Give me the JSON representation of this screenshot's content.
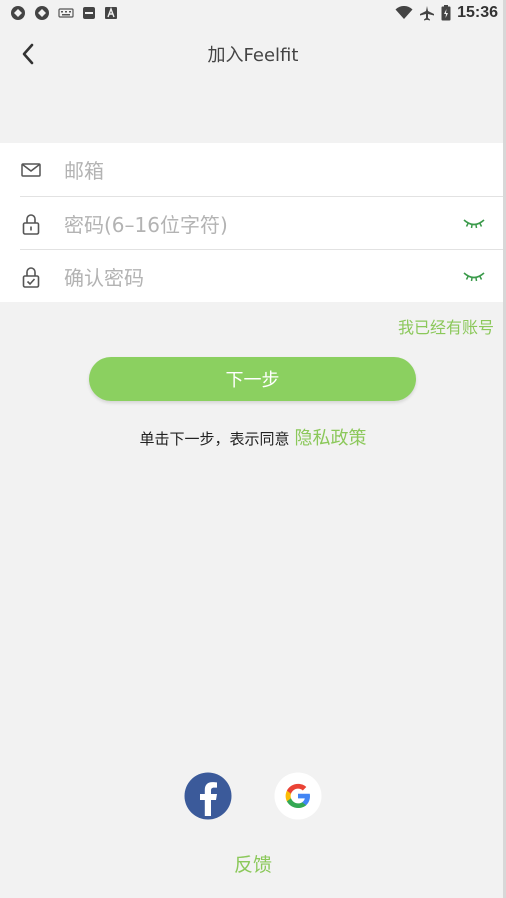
{
  "status_bar": {
    "time": "15:36",
    "left_icons": [
      "sync-icon",
      "sync-icon",
      "keyboard-icon",
      "sd-card-icon",
      "font-a-icon"
    ],
    "right_icons": [
      "wifi-icon",
      "airplane-icon",
      "battery-icon"
    ]
  },
  "header": {
    "title": "加入Feelfit",
    "back_icon": "chevron-left-icon"
  },
  "form": {
    "email_placeholder": "邮箱",
    "password_placeholder": "密码(6–16位字符)",
    "confirm_placeholder": "确认密码",
    "email_icon": "mail-icon",
    "password_icon": "lock-icon",
    "confirm_icon": "lock-check-icon",
    "eye_icon": "eye-closed-icon"
  },
  "login_link": "我已经有账号",
  "next_button": "下一步",
  "agreement": {
    "prefix": "单击下一步，表示同意",
    "link": "隐私政策"
  },
  "social": {
    "facebook": "facebook-icon",
    "google": "google-icon"
  },
  "feedback": "反馈",
  "colors": {
    "accent": "#8bd060",
    "link": "#8bc85a",
    "background": "#f2f2f2",
    "placeholder": "#b3b3b3"
  }
}
